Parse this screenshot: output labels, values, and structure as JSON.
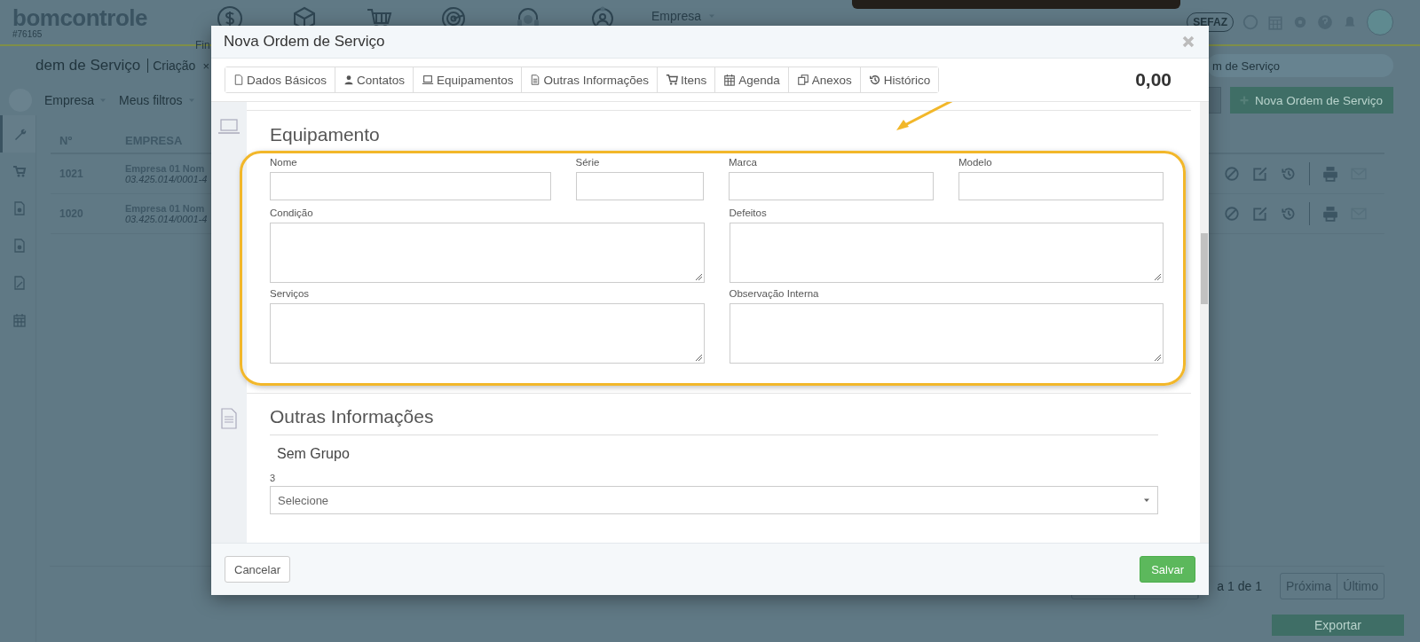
{
  "header": {
    "logo": "bomcontrole",
    "account": "#76165",
    "nav_label": "Fin",
    "menu": "Empresa",
    "badge": "SEFAZ"
  },
  "breadcrumb": {
    "title": "dem de Serviço",
    "tab": "Criação",
    "close": "×"
  },
  "search": {
    "value": "m de Serviço"
  },
  "filters": [
    "Empresa",
    "Meus filtros"
  ],
  "new_button": "Nova Ordem de Serviço",
  "sidebar": [
    {
      "selected": true
    },
    {
      "selected": false
    },
    {
      "selected": false
    },
    {
      "selected": false
    },
    {
      "selected": false
    },
    {
      "selected": false
    }
  ],
  "table": {
    "columns": [
      "Nº",
      "EMPRESA"
    ],
    "rows": [
      {
        "number": "1021",
        "company": "Empresa 01 Nom",
        "document": "03.425.014/0001-4"
      },
      {
        "number": "1020",
        "company": "Empresa 01 Nom",
        "document": "03.425.014/0001-4"
      }
    ]
  },
  "pagination": {
    "info": "a 1 de 1",
    "buttons": [
      {
        "label": "Próxima",
        "disabled": true
      },
      {
        "label": "Último",
        "disabled": true
      }
    ]
  },
  "export_button": "Exportar",
  "modal": {
    "title": "Nova Ordem de Serviço",
    "total": "0,00",
    "tabs": [
      {
        "label": "Dados Básicos",
        "selected": false
      },
      {
        "label": "Contatos",
        "selected": false
      },
      {
        "label": "Equipamentos",
        "selected": false
      },
      {
        "label": "Outras Informações",
        "selected": false
      },
      {
        "label": "Itens",
        "selected": false
      },
      {
        "label": "Agenda",
        "selected": false
      },
      {
        "label": "Anexos",
        "selected": false
      },
      {
        "label": "Histórico",
        "selected": false
      }
    ],
    "equipment": {
      "title": "Equipamento",
      "fields": [
        {
          "label": "Nome",
          "kind": "input"
        },
        {
          "label": "Série",
          "kind": "input"
        },
        {
          "label": "Marca",
          "kind": "input"
        },
        {
          "label": "Modelo",
          "kind": "input"
        },
        {
          "label": "Condição",
          "kind": "textarea"
        },
        {
          "label": "Defeitos",
          "kind": "textarea"
        },
        {
          "label": "Serviços",
          "kind": "textarea"
        },
        {
          "label": "Observação Interna",
          "kind": "textarea"
        }
      ]
    },
    "other": {
      "title": "Outras Informações",
      "group": "Sem Grupo",
      "field_label": "3",
      "placeholder": "Selecione"
    },
    "buttons": {
      "cancel": "Cancelar",
      "save": "Salvar"
    }
  }
}
